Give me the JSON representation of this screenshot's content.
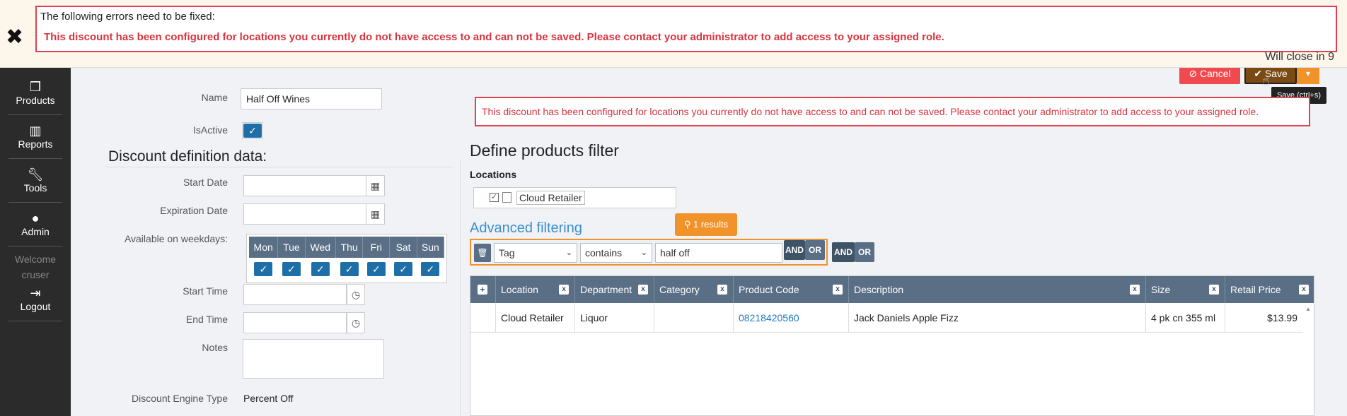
{
  "notification": {
    "heading": "The following errors need to be fixed:",
    "message": "This discount has been configured for locations you currently do not have access to and can not be saved. Please contact your administrator to add access to your assigned role.",
    "countdown": "Will close in 9"
  },
  "sidebar": {
    "items": [
      {
        "label": "Products",
        "icon": "boxes-icon"
      },
      {
        "label": "Reports",
        "icon": "bar-chart-icon"
      },
      {
        "label": "Tools",
        "icon": "wrench-icon"
      },
      {
        "label": "Admin",
        "icon": "user-icon"
      }
    ],
    "welcome": "Welcome",
    "user": "cruser",
    "logout": "Logout"
  },
  "form": {
    "name_label": "Name",
    "name_value": "Half Off Wines",
    "isactive_label": "IsActive",
    "section_title": "Discount definition data:",
    "start_date_label": "Start Date",
    "expiration_date_label": "Expiration Date",
    "weekdays_label": "Available on weekdays:",
    "weekdays": [
      "Mon",
      "Tue",
      "Wed",
      "Thu",
      "Fri",
      "Sat",
      "Sun"
    ],
    "start_time_label": "Start Time",
    "end_time_label": "End Time",
    "notes_label": "Notes",
    "engine_type_label": "Discount Engine Type",
    "engine_type_value": "Percent Off"
  },
  "toolbar": {
    "cancel_label": "Cancel",
    "save_label": "Save",
    "save_tooltip": "Save (ctrl+s)"
  },
  "error_inline": "This discount has been configured for locations you currently do not have access to and can not be saved. Please contact your administrator to add access to your assigned role.",
  "filter": {
    "title": "Define products filter",
    "locations_label": "Locations",
    "location_name": "Cloud Retailer",
    "advanced_title": "Advanced filtering",
    "results_badge": "1 results",
    "field_value": "Tag",
    "operator_value": "contains",
    "search_value": "half off",
    "and_label": "AND",
    "or_label": "OR"
  },
  "grid": {
    "columns": [
      "Location",
      "Department",
      "Category",
      "Product Code",
      "Description",
      "Size",
      "Retail Price"
    ],
    "rows": [
      {
        "location": "Cloud Retailer",
        "department": "Liquor",
        "category": "",
        "product_code": "08218420560",
        "description": "Jack Daniels Apple Fizz",
        "size": "4 pk cn 355 ml",
        "retail_price": "$13.99"
      }
    ]
  },
  "colors": {
    "accent": "#f0932b",
    "error": "#d9343f",
    "header": "#5a6f86",
    "sidebar": "#2b2b2b"
  }
}
